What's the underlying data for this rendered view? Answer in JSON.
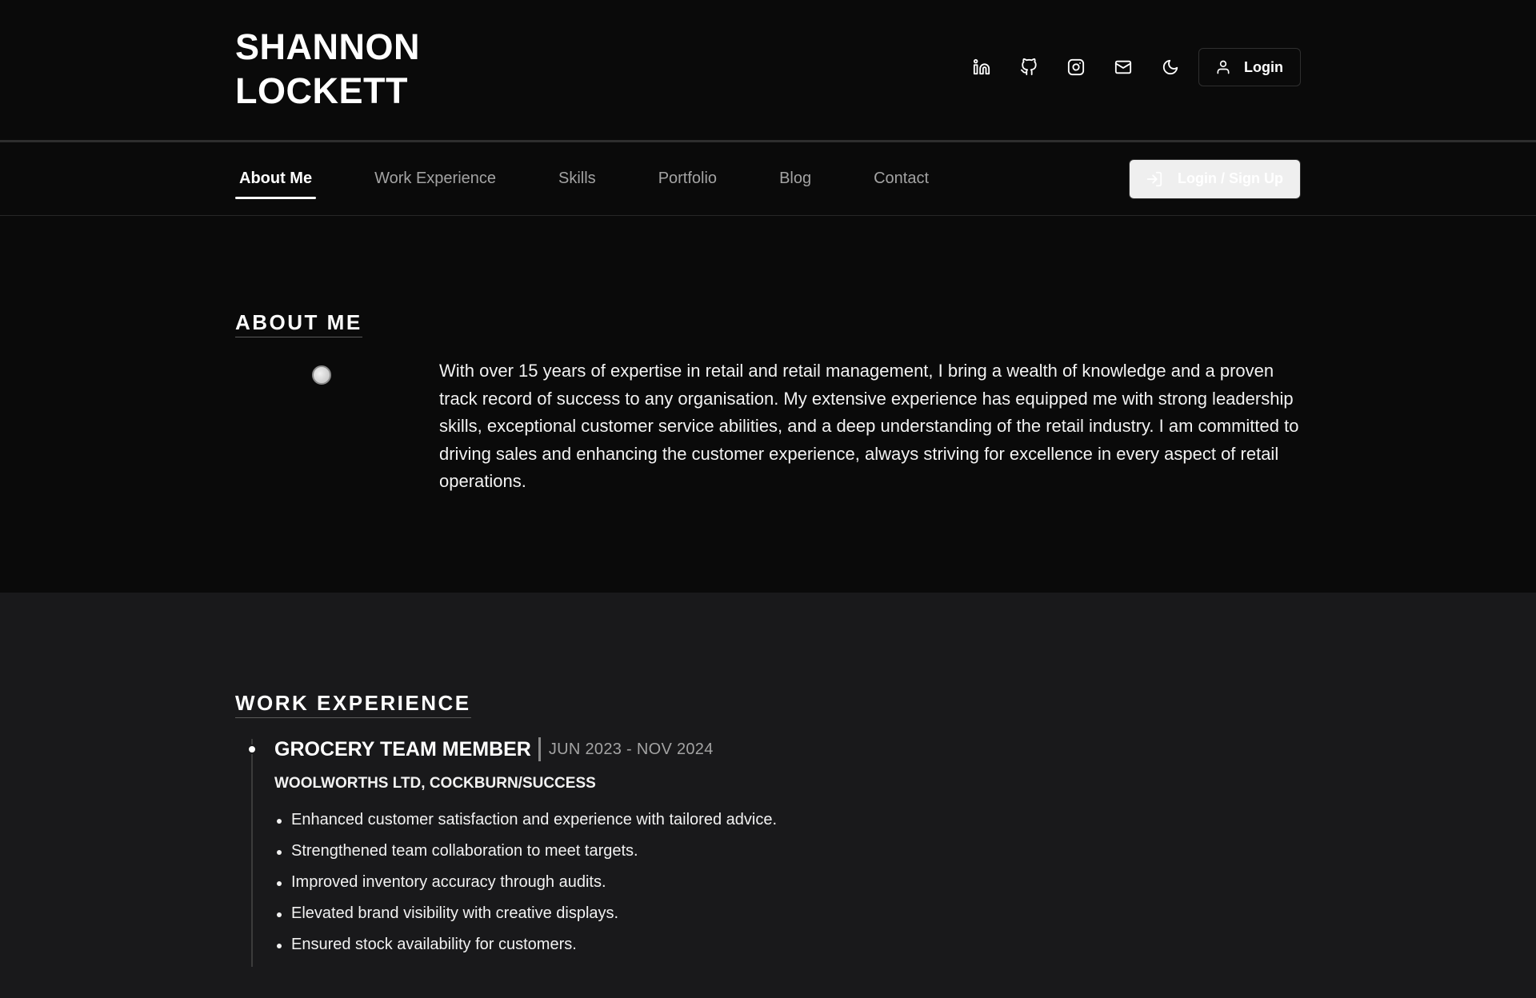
{
  "header": {
    "name_line1": "SHANNON",
    "name_line2": "LOCKETT",
    "icons": [
      "linkedin-icon",
      "github-icon",
      "instagram-icon",
      "mail-icon",
      "moon-icon"
    ],
    "login_label": "Login"
  },
  "nav": {
    "tabs": [
      {
        "label": "About Me",
        "active": true
      },
      {
        "label": "Work Experience",
        "active": false
      },
      {
        "label": "Skills",
        "active": false
      },
      {
        "label": "Portfolio",
        "active": false
      },
      {
        "label": "Blog",
        "active": false
      },
      {
        "label": "Contact",
        "active": false
      }
    ],
    "signup_label": "Login / Sign Up"
  },
  "about": {
    "title": "ABOUT ME",
    "text": "With over 15 years of expertise in retail and retail management, I bring a wealth of knowledge and a proven track record of success to any organisation. My extensive experience has equipped me with strong leadership skills, exceptional customer service abilities, and a deep understanding of the retail industry. I am committed to driving sales and enhancing the customer experience, always striving for excellence in every aspect of retail operations."
  },
  "work": {
    "title": "WORK EXPERIENCE",
    "jobs": [
      {
        "role": "GROCERY TEAM MEMBER",
        "dates": "JUN 2023 - NOV 2024",
        "company": "WOOLWORTHS LTD, COCKBURN/SUCCESS",
        "points": [
          "Enhanced customer satisfaction and experience with tailored advice.",
          "Strengthened team collaboration to meet targets.",
          "Improved inventory accuracy through audits.",
          "Elevated brand visibility with creative displays.",
          "Ensured stock availability for customers."
        ]
      }
    ]
  },
  "colors": {
    "background": "#0a0a0a",
    "section_alt": "#19191b",
    "text": "#ffffff",
    "muted": "#a3a3a3",
    "border": "#2f2f2f"
  }
}
